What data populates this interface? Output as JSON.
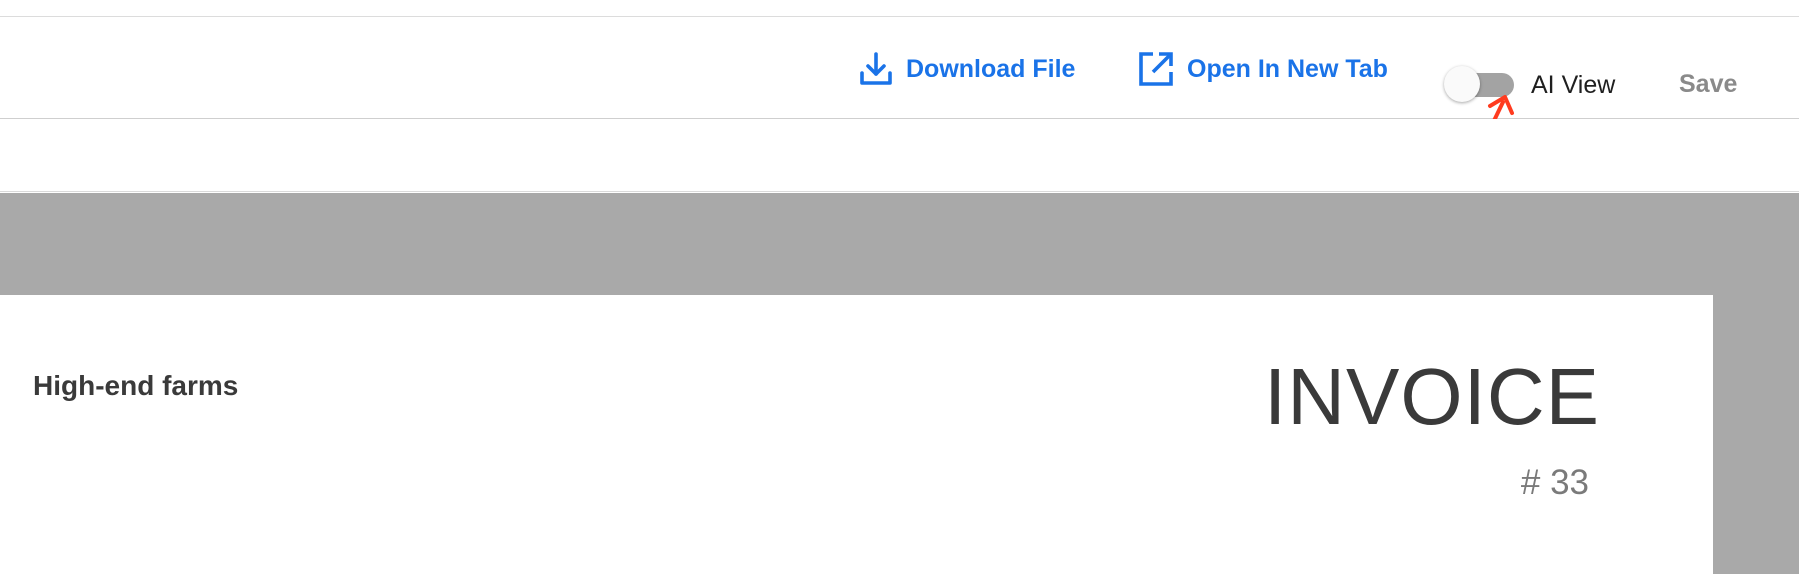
{
  "toolbar": {
    "download_label": "Download File",
    "open_new_tab_label": "Open In New Tab",
    "ai_view_label": "AI View",
    "ai_view_enabled": false,
    "save_label": "Save"
  },
  "document": {
    "company_name": "High-end farms",
    "title": "INVOICE",
    "number": "# 33"
  },
  "colors": {
    "link_blue": "#1a73e8",
    "annotation_red": "#ff3b1f",
    "viewer_gray": "#a9a9a9",
    "toggle_track_off": "#a3a3a3",
    "save_disabled": "#8a8a8a"
  },
  "icons": {
    "download": "download-icon",
    "open_new_tab": "open-in-new-icon",
    "annotation": "annotation-arrow-icon"
  }
}
